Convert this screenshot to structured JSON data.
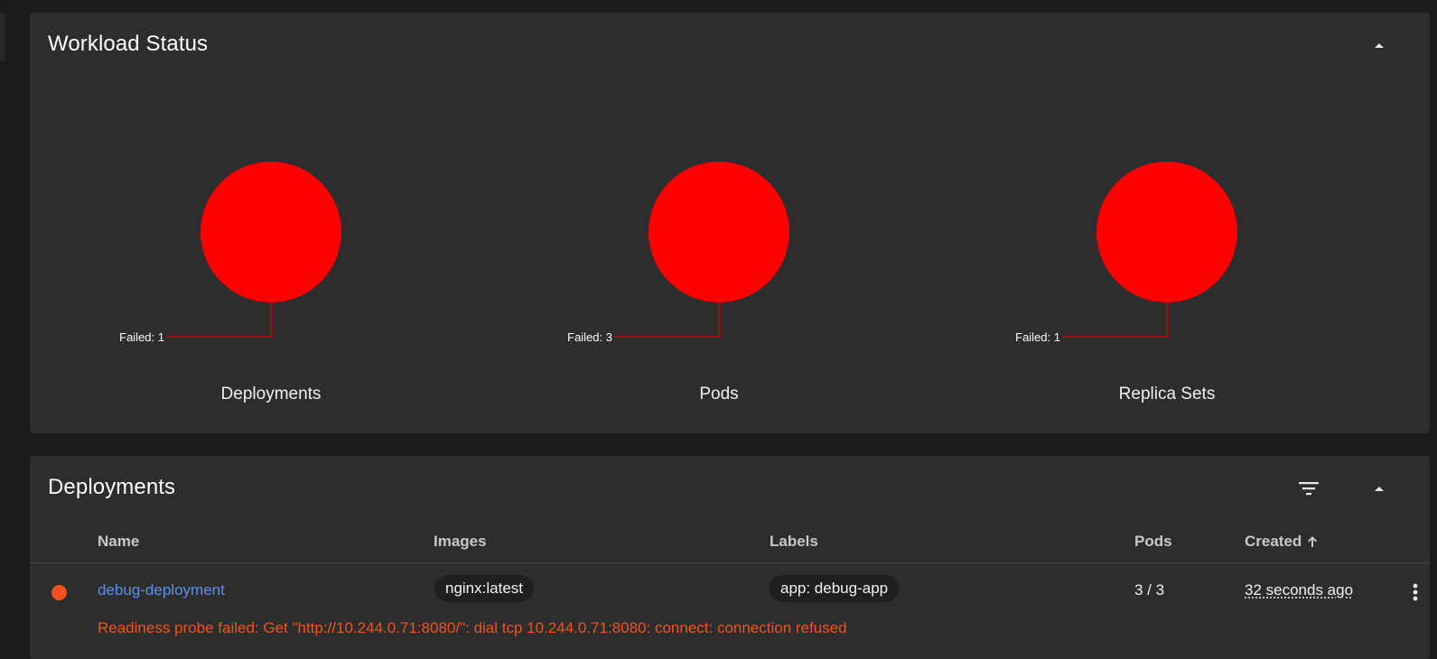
{
  "workload_status": {
    "title": "Workload Status",
    "collapse_icon": "chevron-up-icon"
  },
  "chart_data": [
    {
      "type": "pie",
      "title": "Deployments",
      "slices": [
        {
          "label": "Failed",
          "value": 1
        }
      ],
      "colors": [
        "#ff0000"
      ]
    },
    {
      "type": "pie",
      "title": "Pods",
      "slices": [
        {
          "label": "Failed",
          "value": 3
        }
      ],
      "colors": [
        "#ff0000"
      ]
    },
    {
      "type": "pie",
      "title": "Replica Sets",
      "slices": [
        {
          "label": "Failed",
          "value": 1
        }
      ],
      "colors": [
        "#ff0000"
      ]
    }
  ],
  "charts": [
    {
      "failed_label": "Failed: 1",
      "title": "Deployments"
    },
    {
      "failed_label": "Failed: 3",
      "title": "Pods"
    },
    {
      "failed_label": "Failed: 1",
      "title": "Replica Sets"
    }
  ],
  "deployments": {
    "title": "Deployments",
    "filter_icon": "filter-icon",
    "collapse_icon": "chevron-up-icon",
    "columns": {
      "name": "Name",
      "images": "Images",
      "labels": "Labels",
      "pods": "Pods",
      "created": "Created"
    },
    "sort_icon": "arrow-up-icon",
    "rows": [
      {
        "status_color": "#f4511e",
        "name": "debug-deployment",
        "image": "nginx:latest",
        "label": "app: debug-app",
        "pods": "3 / 3",
        "created": "32 seconds ago",
        "error": "Readiness probe failed: Get \"http://10.244.0.71:8080/\": dial tcp 10.244.0.71:8080: connect: connection refused"
      }
    ]
  },
  "colors": {
    "failed": "#ff0000",
    "link": "#5c8ff0",
    "error": "#f4511e",
    "card": "#2d2d2d",
    "background": "#1b1b1b"
  }
}
